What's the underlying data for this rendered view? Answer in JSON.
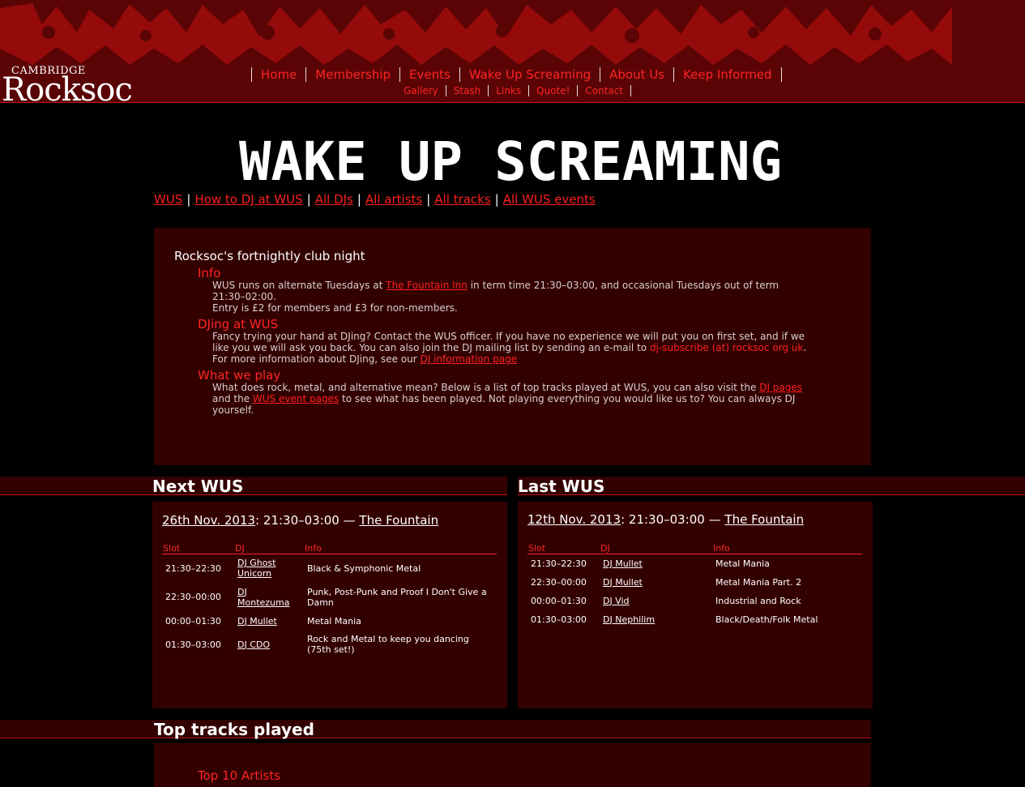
{
  "logo": {
    "line1": "CAMBRIDGE",
    "line2": "Rocksoc"
  },
  "nav_main": [
    "Home",
    "Membership",
    "Events",
    "Wake Up Screaming",
    "About Us",
    "Keep Informed"
  ],
  "nav_sub": [
    "Gallery",
    "Stash",
    "Links",
    "Quote!",
    "Contact"
  ],
  "page_title": "WAKE UP SCREAMING",
  "wus_links": [
    "WUS",
    "How to DJ at WUS",
    "All DJs",
    "All artists",
    "All tracks",
    "All WUS events"
  ],
  "intro": {
    "lead": "Rocksoc's fortnightly club night",
    "info": {
      "heading": "Info",
      "t1": "WUS runs on alternate Tuesdays at ",
      "link": "The Fountain Inn",
      "t2": " in term time 21:30–03:00, and occasional Tuesdays out of term 21:30–02:00.",
      "t3": "Entry is £2 for members and £3 for non-members."
    },
    "djing": {
      "heading": "DJing at WUS",
      "t1": "Fancy trying your hand at DJing? Contact the WUS officer. If you have no experience we will put you on first set, and if we like you we will ask you back. You can also join the DJ mailing list by sending an e-mail to ",
      "email": "dj-subscribe (at) rocksoc org uk",
      "t2": ".",
      "t3": "For more information about DJing, see our ",
      "link": "DJ information page"
    },
    "play": {
      "heading": "What we play",
      "t1": "What does rock, metal, and alternative mean? Below is a list of top tracks played at WUS, you can also visit the ",
      "link1": "DJ pages",
      "t2": " and the ",
      "link2": "WUS event pages",
      "t3": " to see what has been played. Not playing everything you would like us to? You can always DJ yourself."
    }
  },
  "next_wus": {
    "band_title": "Next WUS",
    "date": "26th Nov. 2013",
    "time": ": 21:30–03:00 — ",
    "venue": "The Fountain",
    "headers": [
      "Slot",
      "DJ",
      "Info"
    ],
    "rows": [
      {
        "slot": "21:30–22:30",
        "dj": "DJ Ghost Unicorn",
        "info": "Black & Symphonic Metal"
      },
      {
        "slot": "22:30–00:00",
        "dj": "DJ Montezuma",
        "info": "Punk, Post-Punk and Proof I Don't Give a Damn"
      },
      {
        "slot": "00:00–01:30",
        "dj": "DJ Mullet",
        "info": "Metal Mania"
      },
      {
        "slot": "01:30–03:00",
        "dj": "DJ CDO",
        "info": "Rock and Metal to keep you dancing (75th set!)"
      }
    ]
  },
  "last_wus": {
    "band_title": "Last WUS",
    "date": "12th Nov. 2013",
    "time": ": 21:30–03:00 — ",
    "venue": "The Fountain",
    "headers": [
      "Slot",
      "DJ",
      "Info"
    ],
    "rows": [
      {
        "slot": "21:30–22:30",
        "dj": "DJ Mullet",
        "info": "Metal Mania"
      },
      {
        "slot": "22:30–00:00",
        "dj": "DJ Mullet",
        "info": "Metal Mania Part. 2"
      },
      {
        "slot": "00:00–01:30",
        "dj": "DJ Vid",
        "info": "Industrial and Rock"
      },
      {
        "slot": "01:30–03:00",
        "dj": "DJ Nephilim",
        "info": "Black/Death/Folk Metal"
      }
    ]
  },
  "top_tracks": {
    "band_title": "Top tracks played",
    "sub_heading": "Top 10 Artists"
  },
  "colors": {
    "accent": "#ff1f1f",
    "header_bg": "#5a0405",
    "panel_bg": "#330000"
  }
}
